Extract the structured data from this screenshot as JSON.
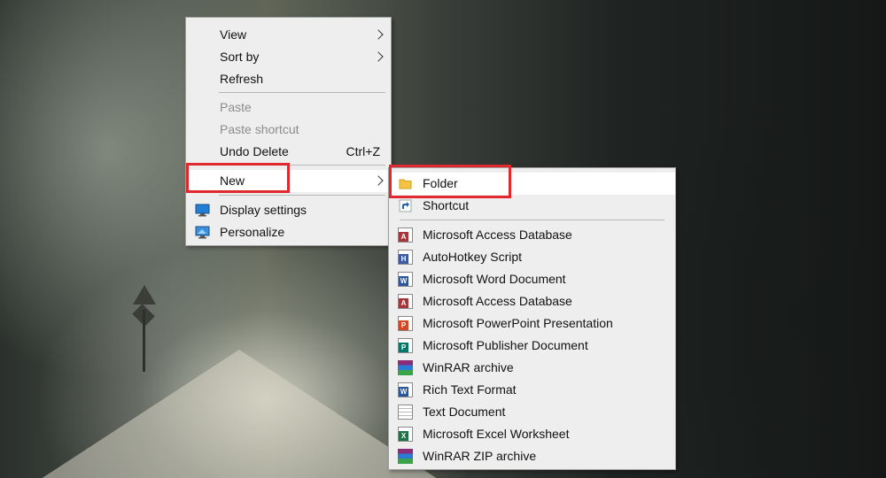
{
  "context_menu": {
    "view_label": "View",
    "sort_by_label": "Sort by",
    "refresh_label": "Refresh",
    "paste_label": "Paste",
    "paste_shortcut_label": "Paste shortcut",
    "undo_delete_label": "Undo Delete",
    "undo_delete_shortcut": "Ctrl+Z",
    "new_label": "New",
    "display_settings_label": "Display settings",
    "personalize_label": "Personalize"
  },
  "new_submenu": {
    "folder_label": "Folder",
    "shortcut_label": "Shortcut",
    "items": [
      {
        "label": "Microsoft Access Database",
        "icon": "access-icon",
        "color": "#a4373a",
        "letter": "A"
      },
      {
        "label": "AutoHotkey Script",
        "icon": "autohotkey-icon",
        "color": "#3b5aa0",
        "letter": "H"
      },
      {
        "label": "Microsoft Word Document",
        "icon": "word-icon",
        "color": "#2b579a",
        "letter": "W"
      },
      {
        "label": "Microsoft Access Database",
        "icon": "access-icon",
        "color": "#a4373a",
        "letter": "A"
      },
      {
        "label": "Microsoft PowerPoint Presentation",
        "icon": "powerpoint-icon",
        "color": "#d24726",
        "letter": "P"
      },
      {
        "label": "Microsoft Publisher Document",
        "icon": "publisher-icon",
        "color": "#077568",
        "letter": "P"
      },
      {
        "label": "WinRAR archive",
        "icon": "winrar-icon",
        "color": "#8b2c7a",
        "letter": ""
      },
      {
        "label": "Rich Text Format",
        "icon": "wordpad-icon",
        "color": "#2b579a",
        "letter": "W"
      },
      {
        "label": "Text Document",
        "icon": "text-document-icon",
        "color": "#ffffff",
        "letter": ""
      },
      {
        "label": "Microsoft Excel Worksheet",
        "icon": "excel-icon",
        "color": "#217346",
        "letter": "X"
      },
      {
        "label": "WinRAR ZIP archive",
        "icon": "winrar-zip-icon",
        "color": "#8b2c7a",
        "letter": ""
      }
    ]
  },
  "colors": {
    "highlight_box": "#e0282e",
    "menu_background": "#eeeeee",
    "folder_yellow": "#f5c242"
  }
}
